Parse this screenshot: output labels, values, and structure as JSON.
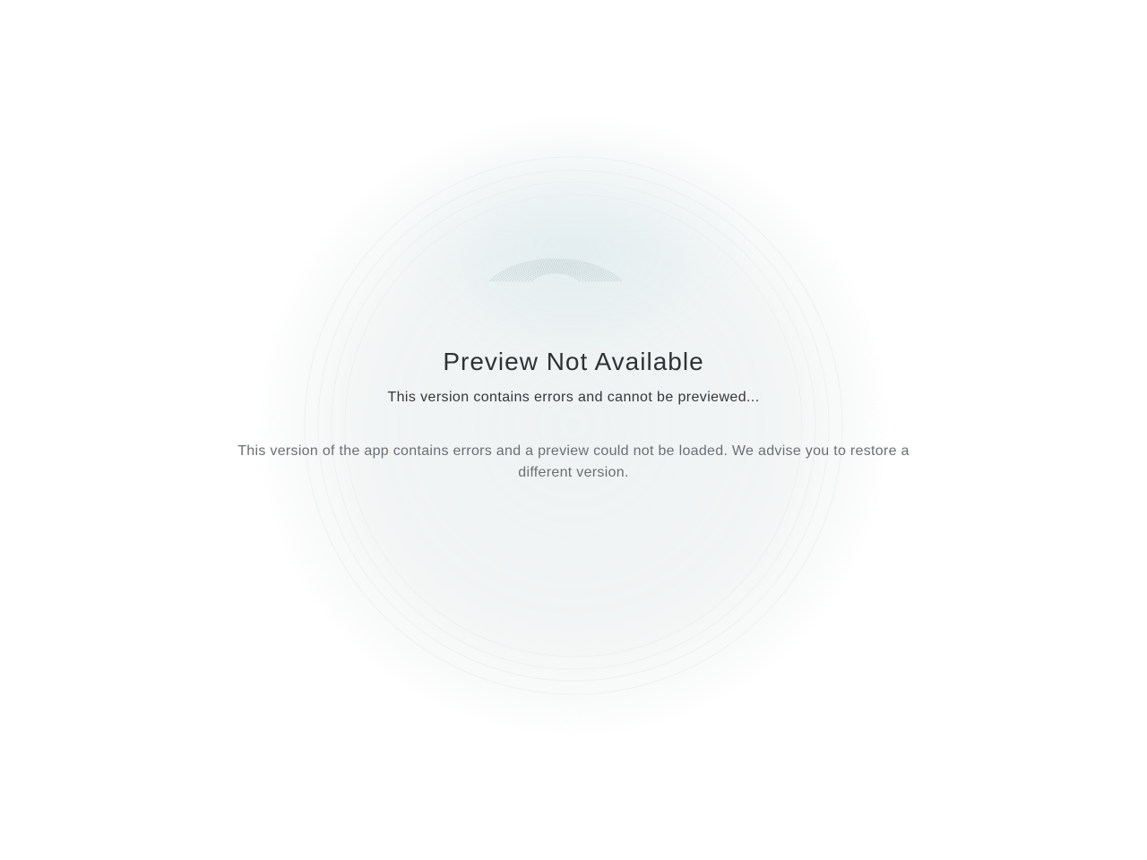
{
  "preview_error": {
    "title": "Preview Not Available",
    "subtitle": "This version contains errors and cannot be previewed...",
    "message": "This version of the app contains errors and a preview could not be loaded. We advise you to restore a different version."
  },
  "colors": {
    "background": "#ffffff",
    "glow": "#eef3f3",
    "title_text": "#2f3234",
    "body_text": "#6b6f72"
  }
}
